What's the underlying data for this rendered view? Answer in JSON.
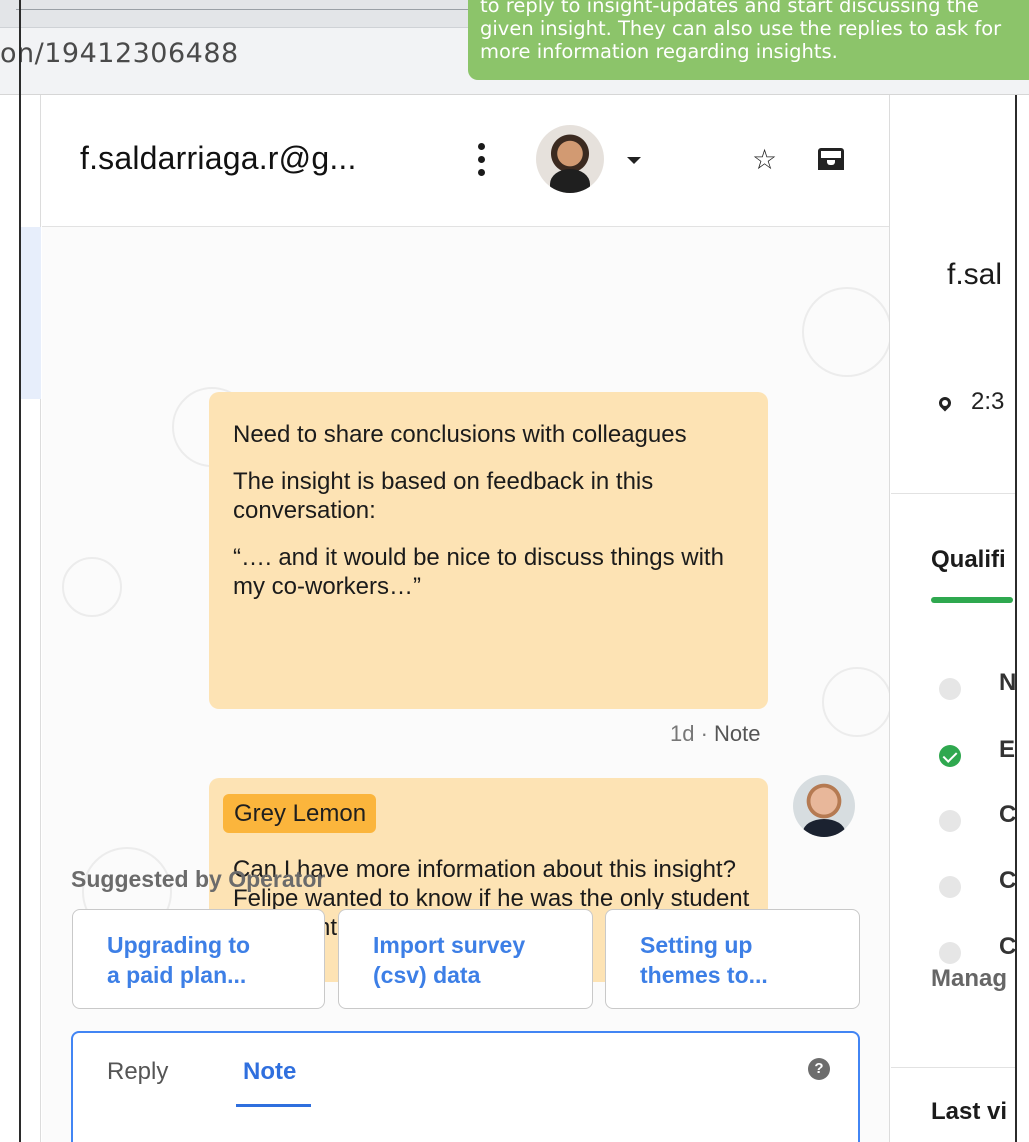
{
  "browser": {
    "url_fragment": "on/19412306488"
  },
  "tooltip": {
    "text": "to reply to insight-updates and start discussing the given insight. They can also use the replies to ask for more information regarding insights."
  },
  "conversation": {
    "title": "f.saldarriaga.r@g...",
    "icons": {
      "more": "vertical-dots-icon",
      "avatar": "user-avatar",
      "caret": "chevron-down-icon",
      "star": "star-icon",
      "inbox": "inbox-icon"
    },
    "note1": {
      "title": "Need to share conclusions with colleagues",
      "body": "The insight is based on feedback in this conversation:",
      "quote": "“…. and it would be nice to discuss things with my co-workers…”",
      "meta_time": "1d",
      "meta_type": "Note"
    },
    "note2": {
      "author": "Grey Lemon",
      "text": "Can I have more information about this insight? Felipe wanted to know if he was the only student who mentioned"
    },
    "suggested": {
      "label": "Suggested by Operator",
      "items": [
        {
          "label": "Upgrading to a paid plan..."
        },
        {
          "label": "Import survey (csv) data"
        },
        {
          "label": "Setting up themes to..."
        }
      ]
    },
    "composer": {
      "tab_reply": "Reply",
      "tab_note": "Note",
      "active_tab": "Note",
      "help": "?"
    }
  },
  "right_panel": {
    "name": "f.sal",
    "time": "2:3",
    "qualification_label": "Qualifi",
    "qualification_items": [
      {
        "letter": "N",
        "done": false
      },
      {
        "letter": "E",
        "done": true
      },
      {
        "letter": "C",
        "done": false
      },
      {
        "letter": "C",
        "done": false
      },
      {
        "letter": "C",
        "done": false
      }
    ],
    "manage": "Manag",
    "last_visited": "Last vi"
  },
  "colors": {
    "note_bg": "#fde3b4",
    "author_tag": "#fbb53c",
    "accent_blue": "#2f6fde",
    "tooltip_green": "#8cc46a",
    "progress_green": "#2fa84f"
  }
}
